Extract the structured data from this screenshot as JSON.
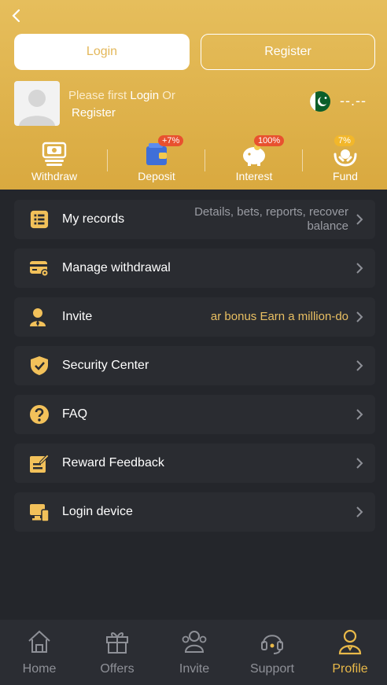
{
  "header": {
    "back_icon": "back-arrow-icon",
    "login_button": "Login",
    "register_button": "Register",
    "prompt_prefix": "Please first ",
    "prompt_login": "Login",
    "prompt_or": " Or",
    "prompt_register": "Register",
    "flag_icon": "pakistan-flag-icon",
    "balance": "--.--",
    "quick_actions": [
      {
        "label": "Withdraw",
        "icon": "withdraw-icon"
      },
      {
        "label": "Deposit",
        "icon": "wallet-icon",
        "badge": "+7%"
      },
      {
        "label": "Interest",
        "icon": "piggy-bank-icon",
        "badge": "100%"
      },
      {
        "label": "Fund",
        "icon": "fund-hands-icon",
        "badge": "7%"
      }
    ]
  },
  "menu": [
    {
      "title": "My records",
      "desc_line1": "Details, bets, reports, recover",
      "desc_line2": "balance",
      "icon": "records-icon"
    },
    {
      "title": "Manage withdrawal",
      "icon": "card-settings-icon"
    },
    {
      "title": "Invite",
      "desc": "ar bonus  Earn a million-do",
      "icon": "invite-user-icon"
    },
    {
      "title": "Security Center",
      "icon": "shield-check-icon"
    },
    {
      "title": "FAQ",
      "icon": "question-icon"
    },
    {
      "title": "Reward Feedback",
      "icon": "feedback-pencil-icon"
    },
    {
      "title": "Login device",
      "icon": "devices-icon"
    }
  ],
  "tabbar": [
    {
      "label": "Home",
      "icon": "home-icon"
    },
    {
      "label": "Offers",
      "icon": "gift-icon"
    },
    {
      "label": "Invite",
      "icon": "people-icon"
    },
    {
      "label": "Support",
      "icon": "headset-icon"
    },
    {
      "label": "Profile",
      "icon": "profile-icon",
      "active": true
    }
  ],
  "colors": {
    "accent": "#e9b949",
    "header": "#e0b24d",
    "background": "#24262b",
    "card": "#2a2c31"
  }
}
